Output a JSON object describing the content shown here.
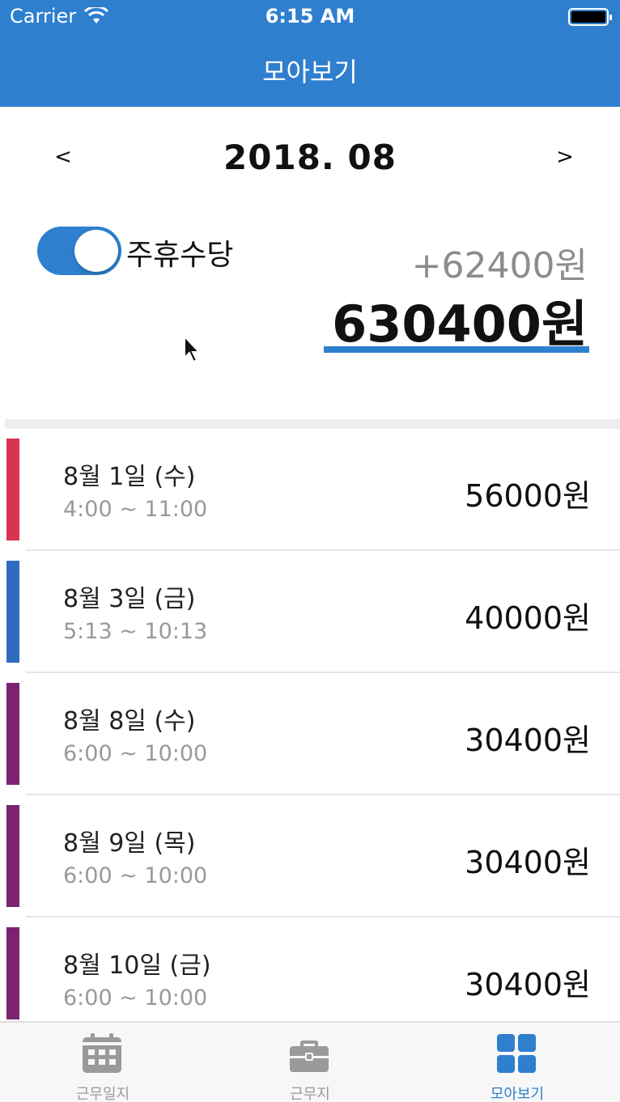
{
  "status_bar": {
    "carrier": "Carrier",
    "time": "6:15 AM"
  },
  "header": {
    "title": "모아보기"
  },
  "month_nav": {
    "prev": "<",
    "label": "2018. 08",
    "next": ">"
  },
  "holiday_allowance": {
    "label": "주휴수당",
    "enabled": true,
    "bonus": "+62400원",
    "total": "630400원"
  },
  "records": [
    {
      "date": "8월 1일 (수)",
      "time": "4:00 ~ 11:00",
      "amount": "56000원",
      "color": "#d8344e"
    },
    {
      "date": "8월 3일 (금)",
      "time": "5:13 ~ 10:13",
      "amount": "40000원",
      "color": "#2f6cc0"
    },
    {
      "date": "8월 8일 (수)",
      "time": "6:00 ~ 10:00",
      "amount": "30400원",
      "color": "#7b2371"
    },
    {
      "date": "8월 9일 (목)",
      "time": "6:00 ~ 10:00",
      "amount": "30400원",
      "color": "#7b2371"
    },
    {
      "date": "8월 10일 (금)",
      "time": "6:00 ~ 10:00",
      "amount": "30400원",
      "color": "#7b2371"
    }
  ],
  "tabs": [
    {
      "label": "근무일지",
      "icon": "calendar-icon",
      "active": false
    },
    {
      "label": "근무지",
      "icon": "briefcase-icon",
      "active": false
    },
    {
      "label": "모아보기",
      "icon": "grid-icon",
      "active": true
    }
  ],
  "colors": {
    "accent": "#2f7fcf"
  }
}
